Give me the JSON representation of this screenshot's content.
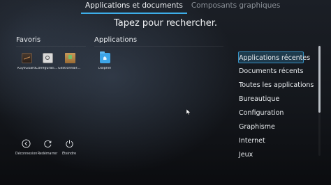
{
  "tabs": [
    {
      "label": "Applications et documents",
      "active": true
    },
    {
      "label": "Composants graphiques",
      "active": false
    }
  ],
  "search": {
    "prompt": "Tapez pour rechercher."
  },
  "favorites": {
    "title": "Favoris",
    "items": [
      {
        "label": "KSysGuard",
        "icon": "ksysguard-icon"
      },
      {
        "label": "Configuration du système",
        "icon": "system-settings-icon"
      },
      {
        "label": "Gestionnaire de paquets",
        "icon": "package-manager-icon"
      }
    ]
  },
  "applications": {
    "title": "Applications",
    "items": [
      {
        "label": "Dolphin",
        "icon": "dolphin-folder-icon"
      }
    ]
  },
  "categories": [
    {
      "label": "Applications récentes",
      "selected": true
    },
    {
      "label": "Documents récents"
    },
    {
      "label": "Toutes les applications"
    },
    {
      "label": "Bureautique"
    },
    {
      "label": "Configuration"
    },
    {
      "label": "Graphisme"
    },
    {
      "label": "Internet"
    },
    {
      "label": "Jeux"
    }
  ],
  "power": [
    {
      "label": "Déconnexion",
      "icon": "logout-icon"
    },
    {
      "label": "Redémarrer",
      "icon": "restart-icon"
    },
    {
      "label": "Éteindre",
      "icon": "shutdown-icon"
    }
  ],
  "colors": {
    "accent": "#3daee9",
    "background": "#14171c"
  }
}
